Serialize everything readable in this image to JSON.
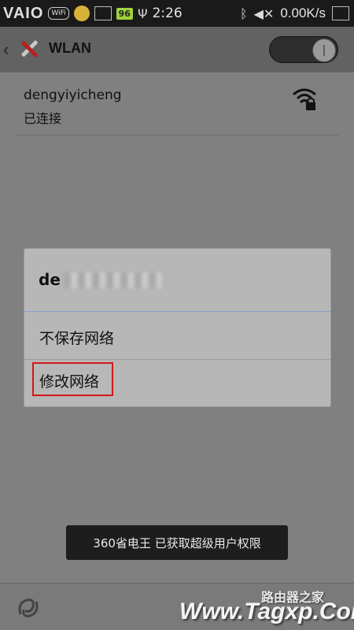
{
  "status_bar": {
    "brand": "VAIO",
    "wifi_badge": "WiFi",
    "battery_badge": "96",
    "time": "2:26",
    "net_speed": "0.00K/s"
  },
  "header": {
    "title": "WLAN",
    "toggle_state": "on"
  },
  "network": {
    "name": "dengyiyicheng",
    "status": "已连接"
  },
  "dialog": {
    "title_prefix": "de",
    "items": [
      {
        "label": "不保存网络"
      },
      {
        "label": "修改网络",
        "highlighted": true
      }
    ]
  },
  "toast": {
    "text": "360省电王 已获取超级用户权限"
  },
  "watermarks": {
    "top": "路由器之家",
    "main": "Www.Tagxp.Com"
  },
  "colors": {
    "highlight": "#d01818",
    "toast_bg": "#1d1d1d",
    "dialog_bg": "#b7b7b7"
  }
}
